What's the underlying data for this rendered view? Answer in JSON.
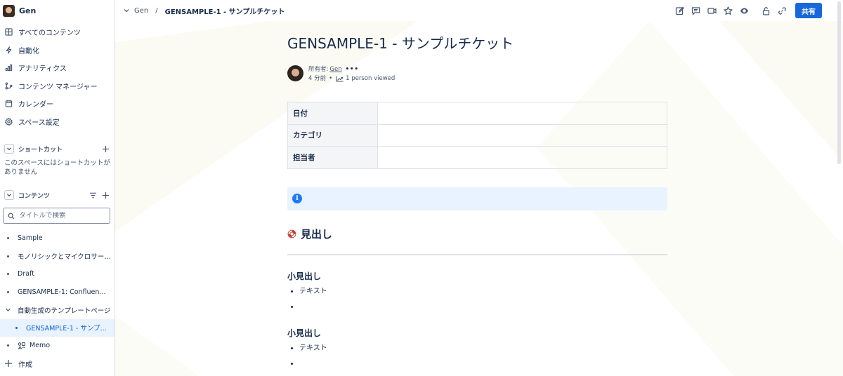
{
  "space": {
    "name": "Gen"
  },
  "sidebar": {
    "nav": [
      {
        "label": "すべてのコンテンツ",
        "icon": "grid-icon"
      },
      {
        "label": "自動化",
        "icon": "lightning-icon"
      },
      {
        "label": "アナリティクス",
        "icon": "bar-chart-icon"
      },
      {
        "label": "コンテンツ マネージャー",
        "icon": "content-manager-icon"
      },
      {
        "label": "カレンダー",
        "icon": "calendar-icon"
      },
      {
        "label": "スペース設定",
        "icon": "gear-icon"
      }
    ],
    "shortcuts": {
      "label": "ショートカット",
      "empty": "このスペースにはショートカットがありません"
    },
    "content": {
      "label": "コンテンツ",
      "search_placeholder": "タイトルで検索",
      "items": [
        {
          "label": "Sample"
        },
        {
          "label": "モノリシックとマイクロサービス..."
        },
        {
          "label": "Draft"
        },
        {
          "label": "GENSAMPLE-1: Confluen..."
        },
        {
          "label": "自動生成のテンプレートページ"
        },
        {
          "label": "GENSAMPLE-1 - サンプ..."
        },
        {
          "label": "Memo"
        }
      ]
    },
    "create_label": "作成"
  },
  "topbar": {
    "breadcrumb": {
      "parent": "Gen",
      "separator": "/",
      "current": "GENSAMPLE-1 - サンプルチケット"
    },
    "share_label": "共有"
  },
  "page": {
    "title": "GENSAMPLE-1 - サンプルチケット",
    "byline": {
      "owner_prefix": "所有者:",
      "owner": "Gen",
      "more": "•••",
      "age": "4 分前",
      "bullet": "•",
      "views": "1 person viewed"
    },
    "properties": [
      {
        "key": "日付",
        "value": ""
      },
      {
        "key": "カテゴリ",
        "value": ""
      },
      {
        "key": "担当者",
        "value": ""
      }
    ],
    "info_icon": "i",
    "heading1": "見出し",
    "sections": [
      {
        "heading": "小見出し",
        "bullets": [
          "テキスト",
          ""
        ]
      },
      {
        "heading": "小見出し",
        "bullets": [
          "テキスト",
          ""
        ]
      }
    ]
  },
  "colors": {
    "primary": "#1868db",
    "selected_bg": "#e9f2ff",
    "info_bg": "#e9f2ff",
    "text": "#172b4d"
  }
}
